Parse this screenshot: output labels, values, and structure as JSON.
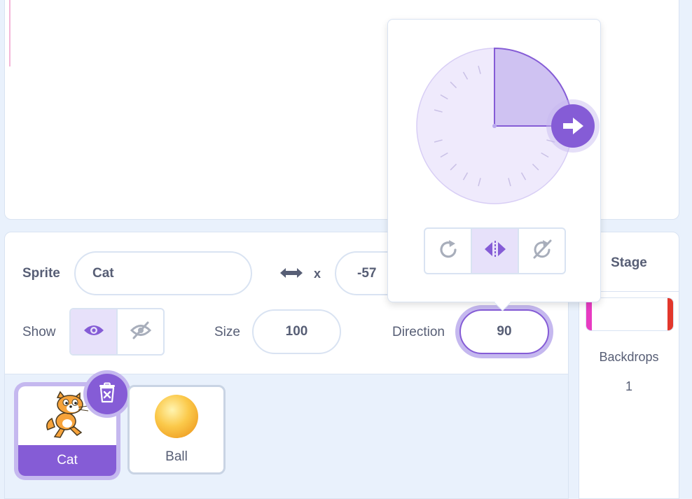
{
  "sprite_info": {
    "sprite_label": "Sprite",
    "sprite_name": "Cat",
    "x_label": "x",
    "x_value": "-57",
    "show_label": "Show",
    "size_label": "Size",
    "size_value": "100",
    "direction_label": "Direction",
    "direction_value": "90",
    "visible": true
  },
  "direction_popover": {
    "angle_degrees": 90,
    "rotation_styles": [
      "all-around",
      "left-right",
      "dont-rotate"
    ],
    "selected_rotation_style": "left-right"
  },
  "sprites": [
    {
      "name": "Cat",
      "selected": true,
      "icon": "cat-sprite-icon"
    },
    {
      "name": "Ball",
      "selected": false,
      "icon": "ball-sprite-icon"
    }
  ],
  "stage": {
    "title": "Stage",
    "backdrops_label": "Backdrops",
    "backdrops_count": "1"
  },
  "colors": {
    "accent": "#855cd6",
    "accent_light": "#c5b8ef",
    "text": "#575e75",
    "border": "#d9e3f2",
    "background": "#e9f1fc"
  }
}
